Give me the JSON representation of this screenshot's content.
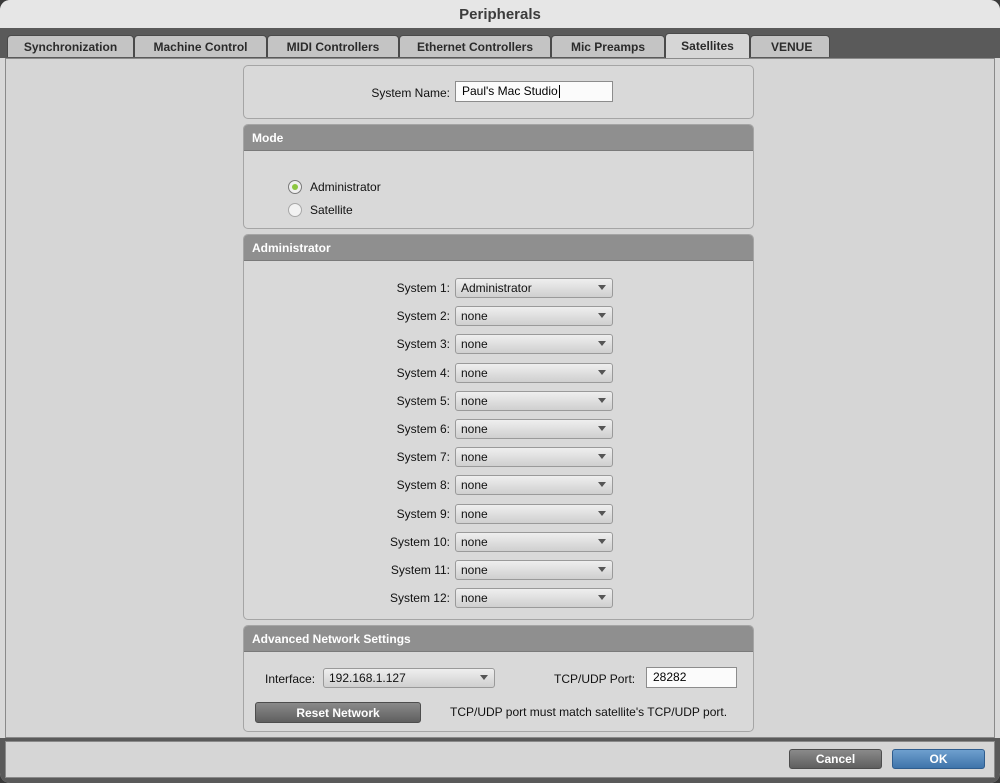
{
  "window": {
    "title": "Peripherals"
  },
  "tabs": [
    "Synchronization",
    "Machine Control",
    "MIDI Controllers",
    "Ethernet Controllers",
    "Mic Preamps",
    "Satellites",
    "VENUE"
  ],
  "active_tab": "Satellites",
  "system_name": {
    "label": "System Name:",
    "value": "Paul's Mac Studio"
  },
  "mode": {
    "header": "Mode",
    "options": [
      {
        "label": "Administrator",
        "selected": true
      },
      {
        "label": "Satellite",
        "selected": false
      }
    ]
  },
  "administrator": {
    "header": "Administrator",
    "systems": [
      {
        "label": "System 1:",
        "value": "Administrator"
      },
      {
        "label": "System 2:",
        "value": "none"
      },
      {
        "label": "System 3:",
        "value": "none"
      },
      {
        "label": "System 4:",
        "value": "none"
      },
      {
        "label": "System 5:",
        "value": "none"
      },
      {
        "label": "System 6:",
        "value": "none"
      },
      {
        "label": "System 7:",
        "value": "none"
      },
      {
        "label": "System 8:",
        "value": "none"
      },
      {
        "label": "System 9:",
        "value": "none"
      },
      {
        "label": "System 10:",
        "value": "none"
      },
      {
        "label": "System 11:",
        "value": "none"
      },
      {
        "label": "System 12:",
        "value": "none"
      }
    ]
  },
  "network": {
    "header": "Advanced Network Settings",
    "interface_label": "Interface:",
    "interface_value": "192.168.1.127",
    "port_label": "TCP/UDP Port:",
    "port_value": "28282",
    "reset_label": "Reset Network",
    "note": "TCP/UDP port must match satellite's TCP/UDP port."
  },
  "footer": {
    "cancel_label": "Cancel",
    "ok_label": "OK"
  },
  "colors": {
    "radio_selected": "#8cc63f",
    "ok_button": "#4a80b8",
    "panel_header": "#8f8f8f"
  }
}
